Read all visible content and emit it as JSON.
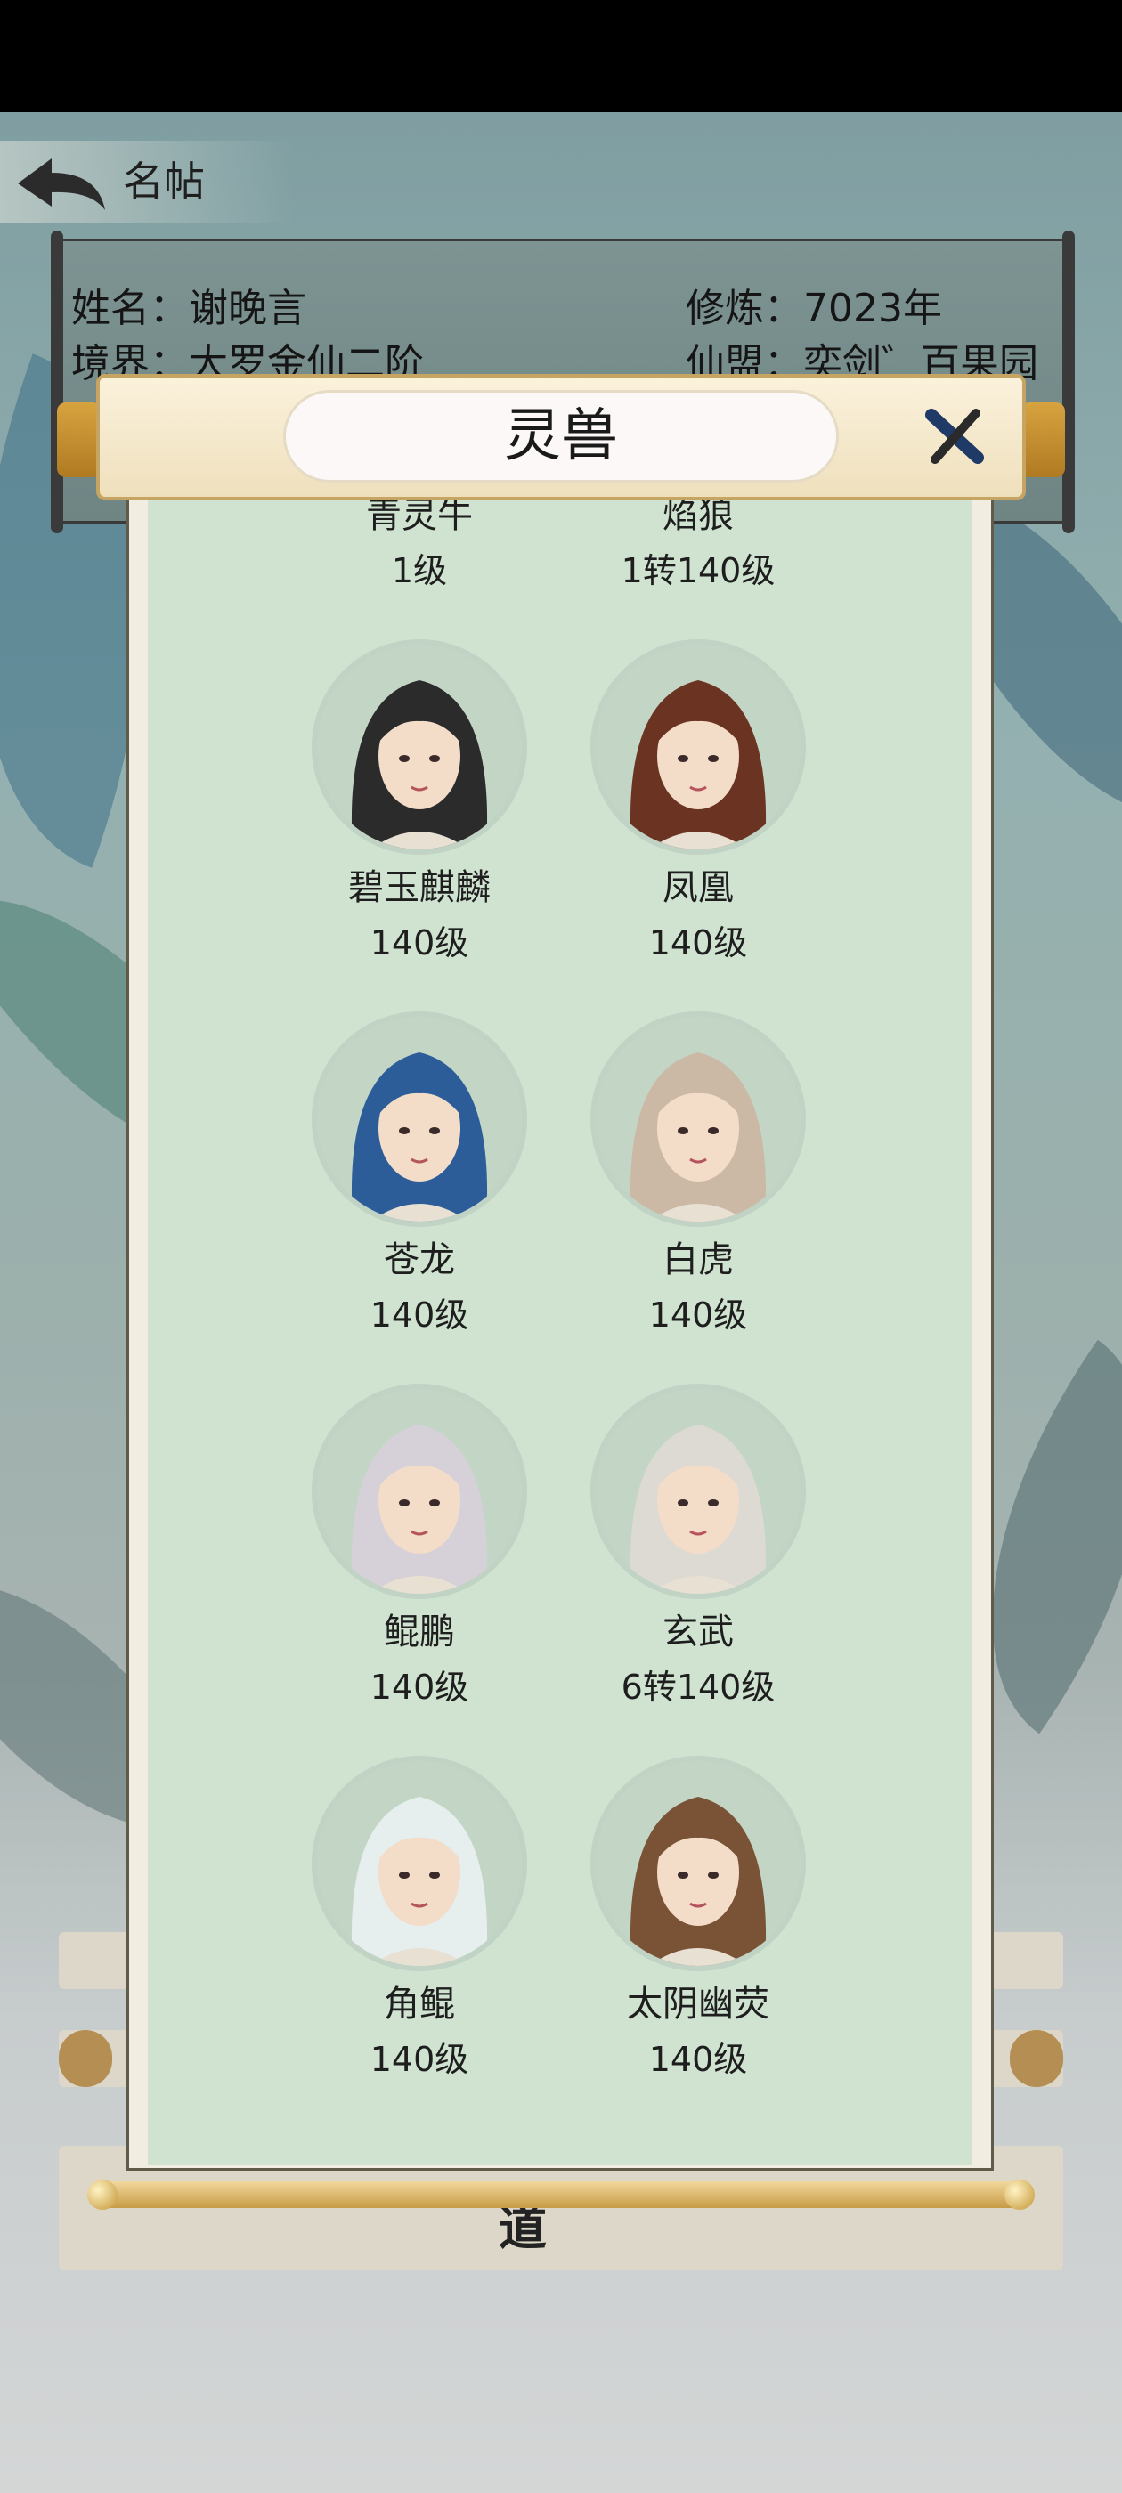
{
  "header": {
    "title": "名帖"
  },
  "profile": {
    "name_label": "姓名：谢晚言",
    "realm_label": "境界：大罗金仙二阶",
    "cultivation_label": "修炼：7023年",
    "alliance_label": "仙盟：奕剑゛百果园"
  },
  "modal": {
    "title": "灵兽",
    "pets": [
      {
        "name": "青灵牛",
        "level": "1级",
        "icon": "qingling-niu-avatar",
        "color": "#2f86b3"
      },
      {
        "name": "焰狼",
        "level": "1转140级",
        "icon": "yan-lang-avatar",
        "color": "#4a4a4a"
      },
      {
        "name": "碧玉麒麟",
        "level": "140级",
        "icon": "biyu-qilin-avatar",
        "color": "#2b2b2b"
      },
      {
        "name": "凤凰",
        "level": "140级",
        "icon": "fenghuang-avatar",
        "color": "#6b3322"
      },
      {
        "name": "苍龙",
        "level": "140级",
        "icon": "canglong-avatar",
        "color": "#2c5d99"
      },
      {
        "name": "白虎",
        "level": "140级",
        "icon": "baihu-avatar",
        "color": "#cbb9a6"
      },
      {
        "name": "鲲鹏",
        "level": "140级",
        "icon": "kunpeng-avatar",
        "color": "#d6d1d8"
      },
      {
        "name": "玄武",
        "level": "6转140级",
        "icon": "xuanwu-avatar",
        "color": "#dddad3"
      },
      {
        "name": "角鲲",
        "level": "140级",
        "icon": "jiaokun-avatar",
        "color": "#e6eeee"
      },
      {
        "name": "太阴幽荧",
        "level": "140级",
        "icon": "taiyin-youying-avatar",
        "color": "#7a5236"
      }
    ]
  },
  "underlay": {
    "button_partial": "道"
  }
}
